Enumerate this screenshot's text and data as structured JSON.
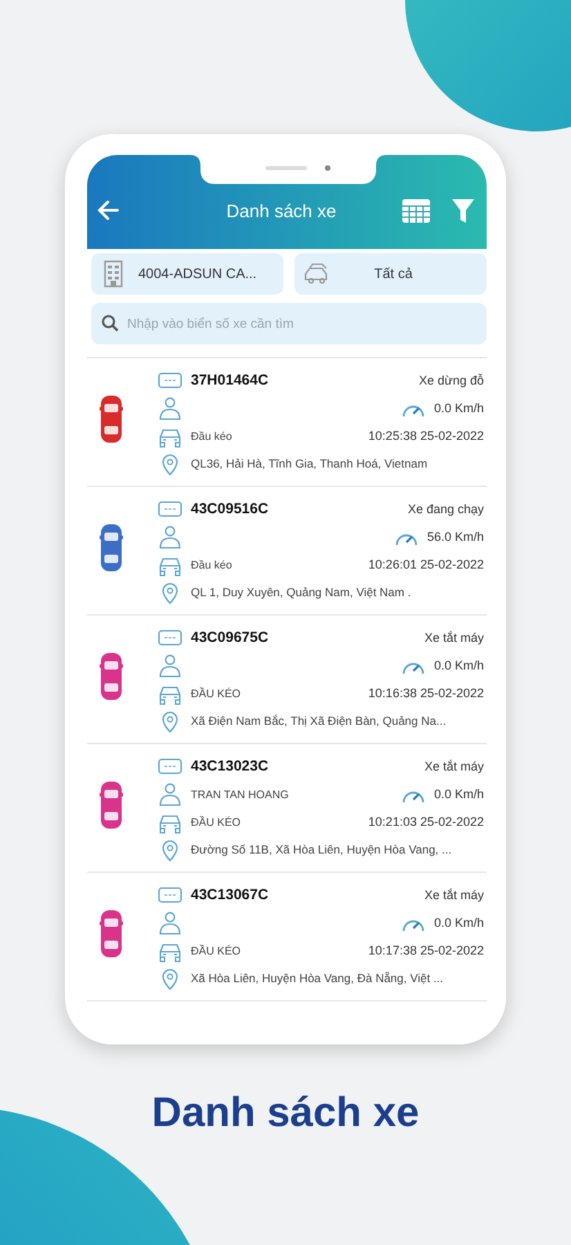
{
  "screen": {
    "title": "Danh sách xe",
    "filters": [
      {
        "kind": "company",
        "label": "4004-ADSUN CA..."
      },
      {
        "kind": "vehicle_type",
        "label": "Tất cả"
      }
    ],
    "search": {
      "placeholder": "Nhập vào biển số xe cần tìm"
    },
    "vehicles": [
      {
        "plate": "37H01464C",
        "status": "Xe dừng đỗ",
        "speed": "0.0 Km/h",
        "type": "Đầu kéo",
        "time": "10:25:38 25-02-2022",
        "address": "QL36, Hải Hà, Tĩnh Gia, Thanh Hoá, Vietnam",
        "color": "#d92b2b"
      },
      {
        "plate": "43C09516C",
        "status": "Xe đang chạy",
        "speed": "56.0 Km/h",
        "type": "Đầu kéo",
        "time": "10:26:01 25-02-2022",
        "address": "QL 1, Duy Xuyên, Quảng Nam, Việt Nam .",
        "color": "#3b6fc6"
      },
      {
        "plate": "43C09675C",
        "status": "Xe tắt máy",
        "speed": "0.0 Km/h",
        "type": "ĐẦU KÉO",
        "time": "10:16:38 25-02-2022",
        "address": "Xã Điện Nam Bắc, Thị Xã Điện Bàn, Quảng Na...",
        "color": "#d9338c"
      },
      {
        "plate": "43C13023C",
        "status": "Xe tắt máy",
        "driver": "TRAN TAN HOANG",
        "speed": "0.0 Km/h",
        "type": "ĐẦU KÉO",
        "time": "10:21:03 25-02-2022",
        "address": "Đường Số 11B, Xã Hòa Liên, Huyện Hòa Vang, ...",
        "color": "#d9338c"
      },
      {
        "plate": "43C13067C",
        "status": "Xe tắt máy",
        "speed": "0.0 Km/h",
        "type": "ĐẦU KÉO",
        "time": "10:17:38 25-02-2022",
        "address": "Xã Hòa Liên, Huyện Hòa Vang, Đà Nẵng, Việt ...",
        "color": "#d9338c"
      }
    ]
  },
  "caption": "Danh sách xe"
}
